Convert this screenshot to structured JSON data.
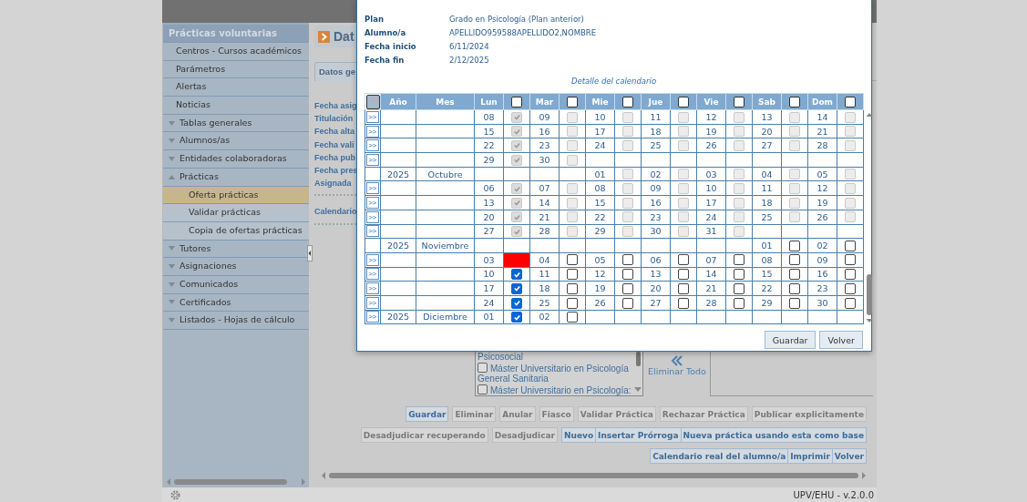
{
  "sidebar": {
    "title": "Prácticas voluntarias",
    "items": [
      {
        "kind": "link",
        "label": "Centros - Cursos académicos",
        "selected": false
      },
      {
        "kind": "link",
        "label": "Parámetros",
        "selected": false
      },
      {
        "kind": "link",
        "label": "Alertas",
        "selected": false
      },
      {
        "kind": "link",
        "label": "Noticias",
        "selected": false
      },
      {
        "kind": "group",
        "label": "Tablas generales",
        "expanded": false
      },
      {
        "kind": "group",
        "label": "Alumnos/as",
        "expanded": false
      },
      {
        "kind": "group",
        "label": "Entidades colaboradoras",
        "expanded": false
      },
      {
        "kind": "group",
        "label": "Prácticas",
        "expanded": true,
        "children": [
          {
            "label": "Oferta prácticas",
            "selected": true
          },
          {
            "label": "Validar prácticas",
            "selected": false
          },
          {
            "label": "Copia de ofertas prácticas",
            "selected": false
          }
        ]
      },
      {
        "kind": "group",
        "label": "Tutores",
        "expanded": false
      },
      {
        "kind": "group",
        "label": "Asignaciones",
        "expanded": false
      },
      {
        "kind": "group",
        "label": "Comunicados",
        "expanded": false
      },
      {
        "kind": "group",
        "label": "Certificados",
        "expanded": false
      },
      {
        "kind": "group",
        "label": "Listados - Hojas de cálculo",
        "expanded": false
      }
    ]
  },
  "content": {
    "header": "Dat",
    "tab": "Datos ge",
    "fields": [
      "Fecha asig",
      "Titulación",
      "Fecha alta",
      "Fecha vali",
      "Fecha pub",
      "Fecha pres",
      "Asignada",
      "Calendario"
    ],
    "study_list": [
      {
        "kind": "tail",
        "label": "Psicosocial"
      },
      {
        "kind": "option",
        "label": "Máster Universitario en Psicología General Sanitaria",
        "checked": false
      },
      {
        "kind": "option",
        "label": "Máster Universitario en Psicología:",
        "checked": false
      }
    ],
    "remove_all": "Eliminar Todo",
    "button_rows": [
      [
        {
          "label": "Guardar",
          "disabled": false
        },
        {
          "label": "Eliminar",
          "disabled": true
        },
        {
          "label": "Anular",
          "disabled": true
        },
        {
          "label": "Fiasco",
          "disabled": true
        },
        {
          "label": "Validar Práctica",
          "disabled": true
        },
        {
          "label": "Rechazar Práctica",
          "disabled": true
        },
        {
          "label": "Publicar explicitamente",
          "disabled": true
        }
      ],
      [
        {
          "label": "Desadjudicar recuperando",
          "disabled": true
        },
        {
          "label": "Desadjudicar",
          "disabled": true
        },
        {
          "label": "Nuevo",
          "disabled": false
        },
        {
          "label": "Insertar Prórroga",
          "disabled": false
        },
        {
          "label": "Nueva práctica usando esta como base",
          "disabled": false
        }
      ],
      [
        {
          "label": "Calendario real del alumno/a",
          "disabled": false
        },
        {
          "label": "Imprimir",
          "disabled": false
        },
        {
          "label": "Volver",
          "disabled": false
        }
      ]
    ]
  },
  "modal": {
    "fields": [
      {
        "label": "Plan",
        "value": "Grado en Psicología (Plan anterior)"
      },
      {
        "label": "Alumno/a",
        "value": "APELLIDO959588APELLIDO2,NOMBRE"
      },
      {
        "label": "Fecha inicio",
        "value": "6/11/2024"
      },
      {
        "label": "Fecha fin",
        "value": "2/12/2025"
      }
    ],
    "caption": "Detalle del calendario",
    "select_all": {
      "checked": false
    },
    "year_header": "Año",
    "month_header": "Mes",
    "weekdays": [
      {
        "label": "Lun",
        "checked": false
      },
      {
        "label": "Mar",
        "checked": false
      },
      {
        "label": "Mie",
        "checked": false
      },
      {
        "label": "Jue",
        "checked": false
      },
      {
        "label": "Vie",
        "checked": false
      },
      {
        "label": "Sab",
        "checked": false
      },
      {
        "label": "Dom",
        "checked": false
      }
    ],
    "rows": [
      {
        "button": ">>",
        "days": {
          "lun": {
            "day": "08",
            "checked": true,
            "disabled": true,
            "flagged": false
          },
          "mar": {
            "day": "09",
            "checked": false,
            "disabled": true,
            "flagged": false
          },
          "mie": {
            "day": "10",
            "checked": false,
            "disabled": true,
            "flagged": false
          },
          "jue": {
            "day": "11",
            "checked": false,
            "disabled": true,
            "flagged": false
          },
          "vie": {
            "day": "12",
            "checked": false,
            "disabled": true,
            "flagged": false
          },
          "sab": {
            "day": "13",
            "checked": false,
            "disabled": true,
            "flagged": false
          },
          "dom": {
            "day": "14",
            "checked": false,
            "disabled": true,
            "flagged": false
          }
        }
      },
      {
        "button": ">>",
        "days": {
          "lun": {
            "day": "15",
            "checked": true,
            "disabled": true,
            "flagged": false
          },
          "mar": {
            "day": "16",
            "checked": false,
            "disabled": true,
            "flagged": false
          },
          "mie": {
            "day": "17",
            "checked": false,
            "disabled": true,
            "flagged": false
          },
          "jue": {
            "day": "18",
            "checked": false,
            "disabled": true,
            "flagged": false
          },
          "vie": {
            "day": "19",
            "checked": false,
            "disabled": true,
            "flagged": false
          },
          "sab": {
            "day": "20",
            "checked": false,
            "disabled": true,
            "flagged": false
          },
          "dom": {
            "day": "21",
            "checked": false,
            "disabled": true,
            "flagged": false
          }
        }
      },
      {
        "button": ">>",
        "days": {
          "lun": {
            "day": "22",
            "checked": true,
            "disabled": true,
            "flagged": false
          },
          "mar": {
            "day": "23",
            "checked": false,
            "disabled": true,
            "flagged": false
          },
          "mie": {
            "day": "24",
            "checked": false,
            "disabled": true,
            "flagged": false
          },
          "jue": {
            "day": "25",
            "checked": false,
            "disabled": true,
            "flagged": false
          },
          "vie": {
            "day": "26",
            "checked": false,
            "disabled": true,
            "flagged": false
          },
          "sab": {
            "day": "27",
            "checked": false,
            "disabled": true,
            "flagged": false
          },
          "dom": {
            "day": "28",
            "checked": false,
            "disabled": true,
            "flagged": false
          }
        }
      },
      {
        "button": ">>",
        "days": {
          "lun": {
            "day": "29",
            "checked": true,
            "disabled": true,
            "flagged": false
          },
          "mar": {
            "day": "30",
            "checked": false,
            "disabled": true,
            "flagged": false
          }
        }
      },
      {
        "year": "2025",
        "month": "Octubre",
        "days": {
          "mie": {
            "day": "01",
            "checked": false,
            "disabled": true,
            "flagged": false
          },
          "jue": {
            "day": "02",
            "checked": false,
            "disabled": true,
            "flagged": false
          },
          "vie": {
            "day": "03",
            "checked": false,
            "disabled": true,
            "flagged": false
          },
          "sab": {
            "day": "04",
            "checked": false,
            "disabled": true,
            "flagged": false
          },
          "dom": {
            "day": "05",
            "checked": false,
            "disabled": true,
            "flagged": false
          }
        }
      },
      {
        "button": ">>",
        "days": {
          "lun": {
            "day": "06",
            "checked": true,
            "disabled": true,
            "flagged": false
          },
          "mar": {
            "day": "07",
            "checked": false,
            "disabled": true,
            "flagged": false
          },
          "mie": {
            "day": "08",
            "checked": false,
            "disabled": true,
            "flagged": false
          },
          "jue": {
            "day": "09",
            "checked": false,
            "disabled": true,
            "flagged": false
          },
          "vie": {
            "day": "10",
            "checked": false,
            "disabled": true,
            "flagged": false
          },
          "sab": {
            "day": "11",
            "checked": false,
            "disabled": true,
            "flagged": false
          },
          "dom": {
            "day": "12",
            "checked": false,
            "disabled": true,
            "flagged": false
          }
        }
      },
      {
        "button": ">>",
        "days": {
          "lun": {
            "day": "13",
            "checked": true,
            "disabled": true,
            "flagged": false
          },
          "mar": {
            "day": "14",
            "checked": false,
            "disabled": true,
            "flagged": false
          },
          "mie": {
            "day": "15",
            "checked": false,
            "disabled": true,
            "flagged": false
          },
          "jue": {
            "day": "16",
            "checked": false,
            "disabled": true,
            "flagged": false
          },
          "vie": {
            "day": "17",
            "checked": false,
            "disabled": true,
            "flagged": false
          },
          "sab": {
            "day": "18",
            "checked": false,
            "disabled": true,
            "flagged": false
          },
          "dom": {
            "day": "19",
            "checked": false,
            "disabled": true,
            "flagged": false
          }
        }
      },
      {
        "button": ">>",
        "days": {
          "lun": {
            "day": "20",
            "checked": true,
            "disabled": true,
            "flagged": false
          },
          "mar": {
            "day": "21",
            "checked": false,
            "disabled": true,
            "flagged": false
          },
          "mie": {
            "day": "22",
            "checked": false,
            "disabled": true,
            "flagged": false
          },
          "jue": {
            "day": "23",
            "checked": false,
            "disabled": true,
            "flagged": false
          },
          "vie": {
            "day": "24",
            "checked": false,
            "disabled": true,
            "flagged": false
          },
          "sab": {
            "day": "25",
            "checked": false,
            "disabled": true,
            "flagged": false
          },
          "dom": {
            "day": "26",
            "checked": false,
            "disabled": true,
            "flagged": false
          }
        }
      },
      {
        "button": ">>",
        "days": {
          "lun": {
            "day": "27",
            "checked": true,
            "disabled": true,
            "flagged": false
          },
          "mar": {
            "day": "28",
            "checked": false,
            "disabled": true,
            "flagged": false
          },
          "mie": {
            "day": "29",
            "checked": false,
            "disabled": true,
            "flagged": false
          },
          "jue": {
            "day": "30",
            "checked": false,
            "disabled": true,
            "flagged": false
          },
          "vie": {
            "day": "31",
            "checked": false,
            "disabled": true,
            "flagged": false
          }
        }
      },
      {
        "year": "2025",
        "month": "Noviembre",
        "days": {
          "sab": {
            "day": "01",
            "checked": false,
            "disabled": false,
            "flagged": false
          },
          "dom": {
            "day": "02",
            "checked": false,
            "disabled": false,
            "flagged": false
          }
        }
      },
      {
        "button": ">>",
        "days": {
          "lun": {
            "day": "03",
            "flagged": true
          },
          "mar": {
            "day": "04",
            "checked": false,
            "disabled": false,
            "flagged": false
          },
          "mie": {
            "day": "05",
            "checked": false,
            "disabled": false,
            "flagged": false
          },
          "jue": {
            "day": "06",
            "checked": false,
            "disabled": false,
            "flagged": false
          },
          "vie": {
            "day": "07",
            "checked": false,
            "disabled": false,
            "flagged": false
          },
          "sab": {
            "day": "08",
            "checked": false,
            "disabled": false,
            "flagged": false
          },
          "dom": {
            "day": "09",
            "checked": false,
            "disabled": false,
            "flagged": false
          }
        }
      },
      {
        "button": ">>",
        "days": {
          "lun": {
            "day": "10",
            "checked": true,
            "disabled": false,
            "flagged": false
          },
          "mar": {
            "day": "11",
            "checked": false,
            "disabled": false,
            "flagged": false
          },
          "mie": {
            "day": "12",
            "checked": false,
            "disabled": false,
            "flagged": false
          },
          "jue": {
            "day": "13",
            "checked": false,
            "disabled": false,
            "flagged": false
          },
          "vie": {
            "day": "14",
            "checked": false,
            "disabled": false,
            "flagged": false
          },
          "sab": {
            "day": "15",
            "checked": false,
            "disabled": false,
            "flagged": false
          },
          "dom": {
            "day": "16",
            "checked": false,
            "disabled": false,
            "flagged": false
          }
        }
      },
      {
        "button": ">>",
        "days": {
          "lun": {
            "day": "17",
            "checked": true,
            "disabled": false,
            "flagged": false
          },
          "mar": {
            "day": "18",
            "checked": false,
            "disabled": false,
            "flagged": false
          },
          "mie": {
            "day": "19",
            "checked": false,
            "disabled": false,
            "flagged": false
          },
          "jue": {
            "day": "20",
            "checked": false,
            "disabled": false,
            "flagged": false
          },
          "vie": {
            "day": "21",
            "checked": false,
            "disabled": false,
            "flagged": false
          },
          "sab": {
            "day": "22",
            "checked": false,
            "disabled": false,
            "flagged": false
          },
          "dom": {
            "day": "23",
            "checked": false,
            "disabled": false,
            "flagged": false
          }
        }
      },
      {
        "button": ">>",
        "days": {
          "lun": {
            "day": "24",
            "checked": true,
            "disabled": false,
            "flagged": false
          },
          "mar": {
            "day": "25",
            "checked": false,
            "disabled": false,
            "flagged": false
          },
          "mie": {
            "day": "26",
            "checked": false,
            "disabled": false,
            "flagged": false
          },
          "jue": {
            "day": "27",
            "checked": false,
            "disabled": false,
            "flagged": false
          },
          "vie": {
            "day": "28",
            "checked": false,
            "disabled": false,
            "flagged": false
          },
          "sab": {
            "day": "29",
            "checked": false,
            "disabled": false,
            "flagged": false
          },
          "dom": {
            "day": "30",
            "checked": false,
            "disabled": false,
            "flagged": false
          }
        }
      },
      {
        "button": ">>",
        "year": "2025",
        "month": "Diciembre",
        "days": {
          "lun": {
            "day": "01",
            "checked": true,
            "disabled": false,
            "flagged": false
          },
          "mar": {
            "day": "02",
            "checked": false,
            "disabled": false,
            "flagged": false
          }
        }
      }
    ],
    "buttons": [
      "Guardar",
      "Volver"
    ]
  },
  "footer": "UPV/EHU - v.2.0.0"
}
